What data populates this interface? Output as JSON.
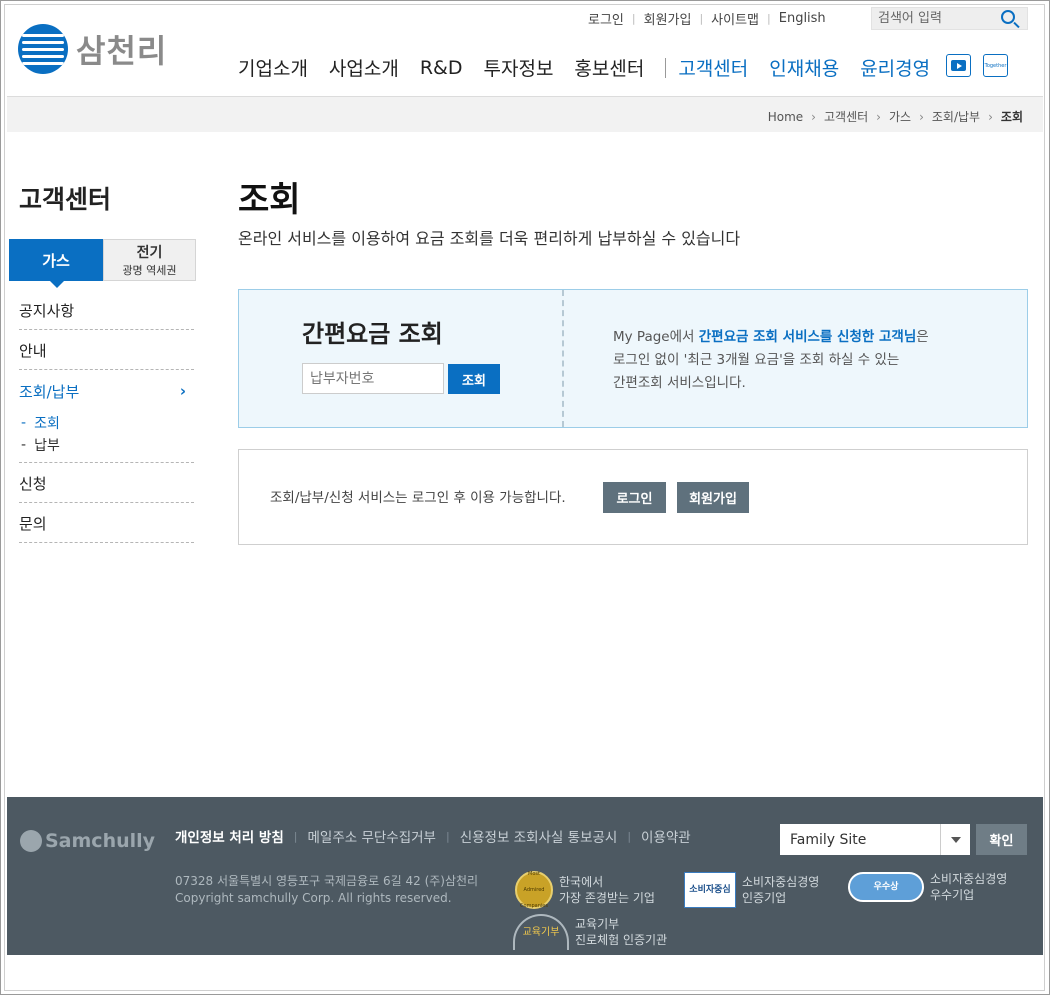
{
  "header": {
    "logo_text": "삼천리",
    "util_links": [
      "로그인",
      "회원가입",
      "사이트맵",
      "English"
    ],
    "search_placeholder": "검색어 입력",
    "gnb": [
      "기업소개",
      "사업소개",
      "R&D",
      "투자정보",
      "홍보센터"
    ],
    "gnb_blue": [
      "고객센터",
      "인재채용",
      "윤리경영"
    ],
    "together_label": "Together"
  },
  "breadcrumb": [
    "Home",
    "고객센터",
    "가스",
    "조회/납부",
    "조회"
  ],
  "side": {
    "title": "고객센터",
    "tab_gas": "가스",
    "tab_elec": "전기",
    "tab_elec_sub": "광명 역세권",
    "menu": [
      "공지사항",
      "안내",
      "조회/납부",
      "신청",
      "문의"
    ],
    "sub": [
      "조회",
      "납부"
    ]
  },
  "main": {
    "title": "조회",
    "desc": "온라인 서비스를 이용하여 요금 조회를 더욱 편리하게 납부하실 수 있습니다",
    "quick_title": "간편요금 조회",
    "quick_placeholder": "납부자번호",
    "quick_button": "조회",
    "info_line1_pre": "My Page에서 ",
    "info_line1_bold": "간편요금 조회 서비스를 신청한 고객님",
    "info_line1_post": "은",
    "info_line2": "로그인 없이 '최근 3개월 요금'을 조회 하실 수 있는",
    "info_line3": "간편조회 서비스입니다.",
    "login_msg": "조회/납부/신청 서비스는 로그인 후 이용 가능합니다.",
    "login_button": "로그인",
    "join_button": "회원가입"
  },
  "footer": {
    "logo_text": "Samchully",
    "links": [
      "개인정보 처리 방침",
      "메일주소 무단수집거부",
      "신용정보 조회사실 통보공시",
      "이용약관"
    ],
    "family_site": "Family Site",
    "confirm": "확인",
    "address": "07328 서울특별시 영등포구 국제금융로 6길 42 (주)삼천리",
    "copyright": "Copyright samchully Corp. All rights reserved.",
    "award1_l1": "한국에서",
    "award1_l2": "가장 존경받는 기업",
    "award2_l1": "소비자중심경영",
    "award2_l2": "인증기업",
    "award3_l1": "소비자중심경영",
    "award3_l2": "우수기업",
    "award4_l1": "교육기부",
    "award4_l2": "진로체험 인증기관",
    "badge1_text": "Most Admired Companies",
    "badge2_text": "소비자중심",
    "badge3_text": "우수상",
    "badge4_text": "교육기부"
  },
  "colors": {
    "brand_blue": "#0a6fc2",
    "footer_bg": "#4d5962",
    "quick_bg": "#eef7fc"
  }
}
